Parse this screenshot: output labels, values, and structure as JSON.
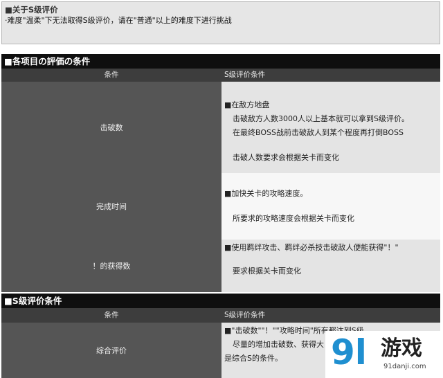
{
  "note": {
    "title": "■关于S级评价",
    "text": "·难度\"温柔\"下无法取得S级评价，请在\"普通\"以上的难度下进行挑战"
  },
  "section1": {
    "title": "■各项目の評価の条件",
    "header": {
      "col1": "条件",
      "col2": "S级评价条件"
    },
    "rows": [
      {
        "label": "击破数",
        "lines": [
          "■在敌方地盘",
          "击破敌方人数3000人以上基本就可以拿到S级评价。",
          "在最终BOSS战前击破敌人到某个程度再打倒BOSS",
          "击破人数要求会根据关卡而变化"
        ]
      },
      {
        "label": "完成时间",
        "lines": [
          "■加快关卡的攻略速度。",
          "所要求的攻略速度会根据关卡而变化"
        ]
      },
      {
        "label": "！的获得数",
        "lines": [
          "■使用羁绊攻击、羁绊必杀技击破敌人便能获得\"！\"",
          "要求根据关卡而变化"
        ]
      }
    ]
  },
  "section2": {
    "title": "■S级评价条件",
    "header": {
      "col1": "条件",
      "col2": "S级评价条件"
    },
    "rows": [
      {
        "label": "综合评价",
        "lines": [
          "■\"击破数\"\"！\"\"攻略时间\"所有都达到S级。",
          "尽量的增加击破数、获得大",
          "是综合S的条件。"
        ]
      }
    ]
  },
  "watermark": {
    "brand_num": "9l",
    "brand_cn": "游戏",
    "url": "91danji.com"
  }
}
